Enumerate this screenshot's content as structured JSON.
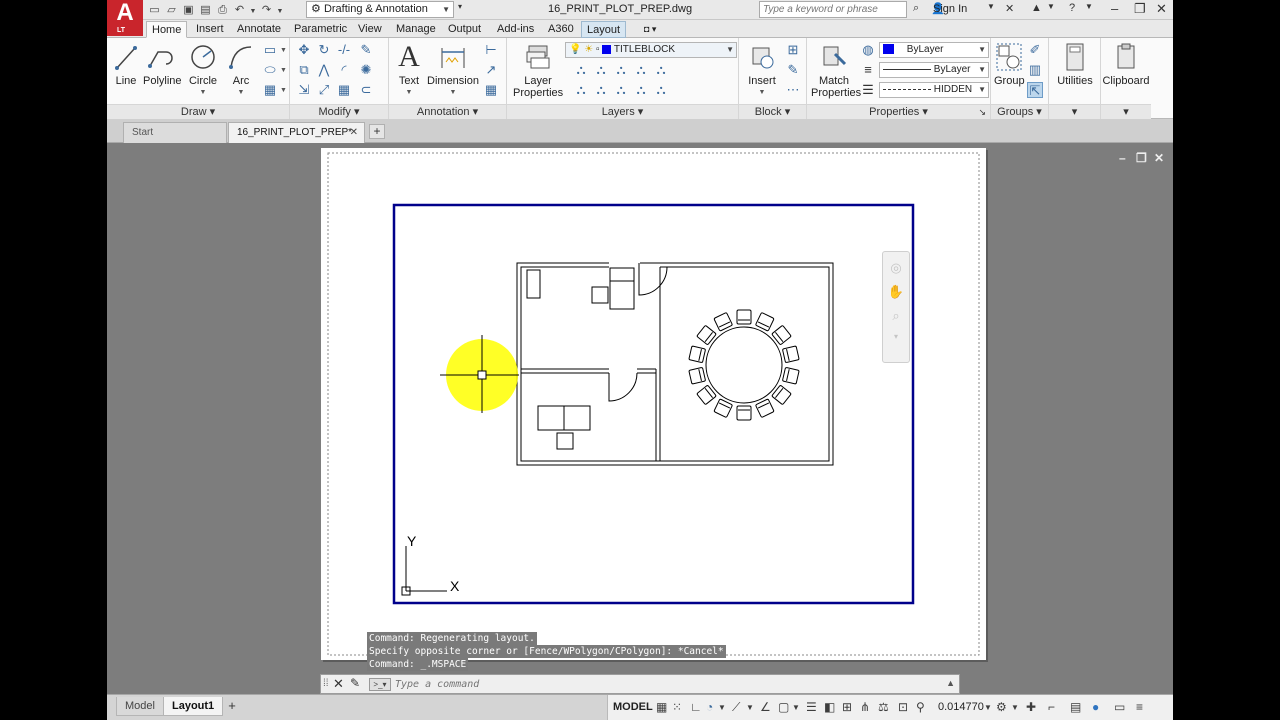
{
  "app": {
    "logo_letter": "A",
    "logo_sub": "LT",
    "workspace": "Drafting & Annotation",
    "doc_title": "16_PRINT_PLOT_PREP.dwg",
    "search_placeholder": "Type a keyword or phrase",
    "sign_in": "Sign In"
  },
  "ribbon_tabs": [
    "Home",
    "Insert",
    "Annotate",
    "Parametric",
    "View",
    "Manage",
    "Output",
    "Add-ins",
    "A360",
    "Layout"
  ],
  "ribbon": {
    "draw": {
      "title": "Draw",
      "line": "Line",
      "polyline": "Polyline",
      "circle": "Circle",
      "arc": "Arc"
    },
    "modify": {
      "title": "Modify"
    },
    "annotation": {
      "title": "Annotation",
      "text": "Text",
      "dimension": "Dimension"
    },
    "layers": {
      "title": "Layers",
      "layer_properties_1": "Layer",
      "layer_properties_2": "Properties",
      "current_layer": "TITLEBLOCK",
      "layer_color": "#0000ee"
    },
    "block": {
      "title": "Block",
      "insert": "Insert"
    },
    "properties": {
      "title": "Properties",
      "match_1": "Match",
      "match_2": "Properties",
      "color": "ByLayer",
      "lineweight": "ByLayer",
      "linetype": "HIDDEN"
    },
    "groups": {
      "title": "Groups",
      "group": "Group"
    },
    "utilities": "Utilities",
    "clipboard": "Clipboard"
  },
  "file_tabs": {
    "start": "Start",
    "active": "16_PRINT_PLOT_PREP*"
  },
  "command_history": [
    "Command: Regenerating layout.",
    "Specify opposite corner or [Fence/WPolygon/CPolygon]: *Cancel*",
    "Command: _.MSPACE"
  ],
  "command_line": {
    "placeholder": "Type a command"
  },
  "status": {
    "model_tab": "Model",
    "layout_tab": "Layout1",
    "space": "MODEL",
    "scale": "0.014770"
  },
  "ucs": {
    "x_label": "X",
    "y_label": "Y"
  },
  "colors": {
    "viewport_border": "#00008b",
    "cursor_highlight": "#ffff00",
    "logo_red": "#c9252c"
  }
}
